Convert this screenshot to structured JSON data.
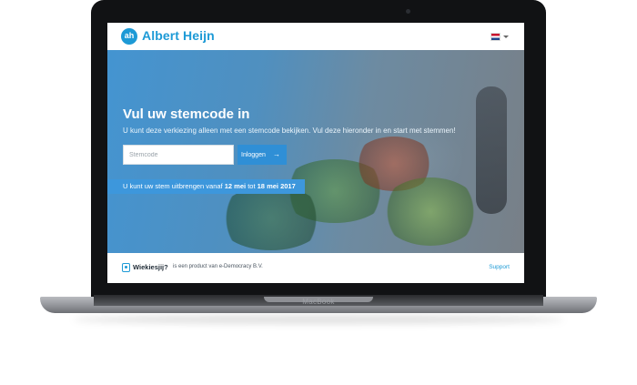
{
  "device": {
    "brand_label": "MacBook"
  },
  "header": {
    "logo_mark": "ah",
    "logo_text": "Albert Heijn",
    "language_flag": "flag-nl-icon"
  },
  "hero": {
    "title": "Vul uw stemcode in",
    "subtitle": "U kunt deze verkiezing alleen met een stemcode bekijken. Vul deze hieronder in en start met stemmen!",
    "code_input": {
      "placeholder": "Stemcode",
      "value": ""
    },
    "login_button": {
      "label": "Inloggen",
      "icon": "arrow-right-icon"
    },
    "voting_period": {
      "prefix": "U kunt uw stem uitbrengen vanaf",
      "start": "12 mei",
      "middle": "tot",
      "end": "18 mei 2017"
    }
  },
  "footer": {
    "product_name": "Wiekiesjij?",
    "product_description": "is een product van e-Democracy B.V.",
    "support_link": "Support"
  },
  "colors": {
    "brand_blue": "#1d9ad6",
    "button_blue": "#2f8fd6",
    "banner_blue": "#3d97dc"
  }
}
